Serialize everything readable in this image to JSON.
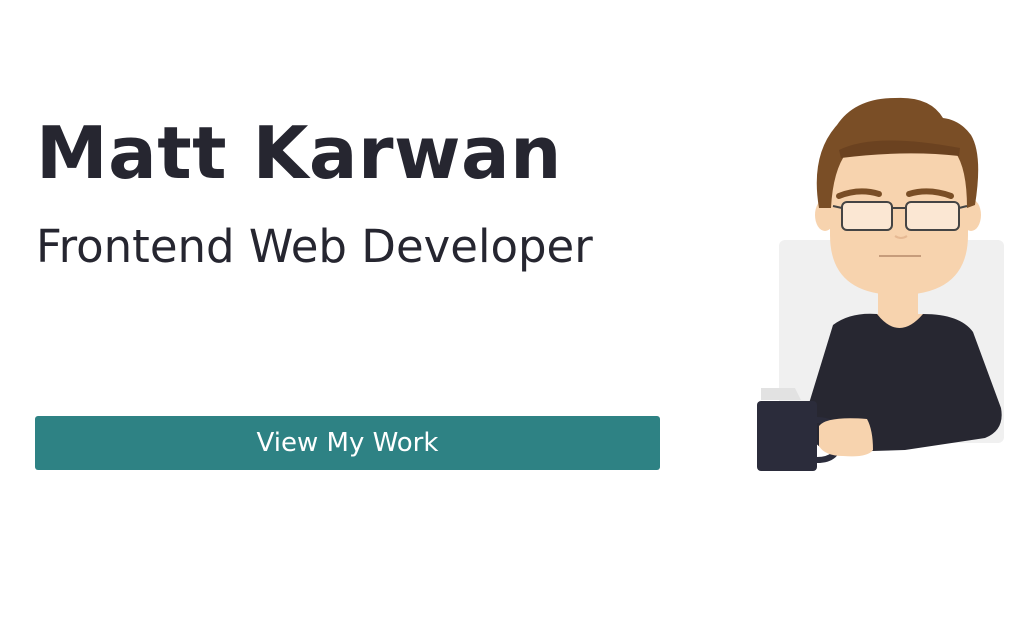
{
  "hero": {
    "name": "Matt Karwan",
    "role": "Frontend Web Developer",
    "cta_label": "View My Work"
  },
  "colors": {
    "text": "#262630",
    "accent": "#2e8284",
    "background": "#ffffff"
  },
  "icons": {
    "avatar": "developer-avatar-illustration"
  }
}
